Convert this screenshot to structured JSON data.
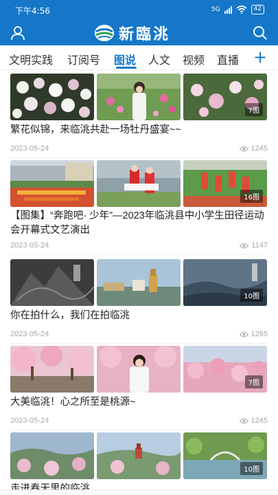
{
  "status_bar": {
    "time": "下午4:56",
    "network": "5G",
    "battery": "42"
  },
  "header": {
    "logo_text": "新臨洮",
    "user_icon": "user-icon",
    "search_icon": "search-icon"
  },
  "tabs": [
    {
      "label": "文明实践",
      "active": false
    },
    {
      "label": "订阅号",
      "active": false
    },
    {
      "label": "图说",
      "active": true
    },
    {
      "label": "人文",
      "active": false
    },
    {
      "label": "视频",
      "active": false
    },
    {
      "label": "直播",
      "active": false
    }
  ],
  "add_label": "+",
  "feed": [
    {
      "title": "繁花似锦，来临洮共赴一场牡丹盛宴~~",
      "date": "2023-05-24",
      "views": "1245",
      "badge": "7图"
    },
    {
      "title": "【图集】“奔跑吧· 少年”—2023年临洮县中小学生田径运动会开幕式文艺演出",
      "date": "2023-05-24",
      "views": "1147",
      "badge": "16图"
    },
    {
      "title": "你在拍什么，我们在拍临洮",
      "date": "2023-05-24",
      "views": "1265",
      "badge": "10图"
    },
    {
      "title": "大美临洮！心之所至是桃源~",
      "date": "2023-05-24",
      "views": "1245",
      "badge": "7图"
    },
    {
      "title": "走进春天里的临洮",
      "date": "",
      "views": "",
      "badge": "10图"
    }
  ],
  "colors": {
    "brand": "#1677c8",
    "meta": "#a8a8a8"
  }
}
